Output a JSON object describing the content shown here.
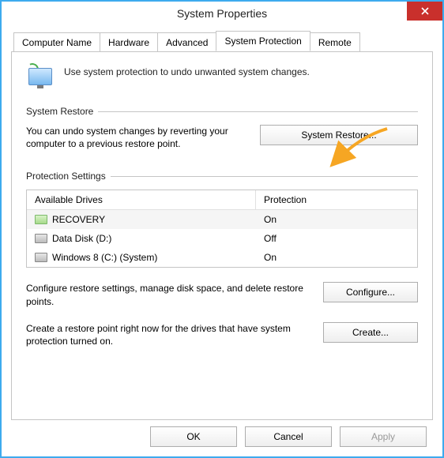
{
  "window": {
    "title": "System Properties"
  },
  "tabs": [
    {
      "label": "Computer Name"
    },
    {
      "label": "Hardware"
    },
    {
      "label": "Advanced"
    },
    {
      "label": "System Protection"
    },
    {
      "label": "Remote"
    }
  ],
  "intro": "Use system protection to undo unwanted system changes.",
  "restore": {
    "section": "System Restore",
    "desc": "You can undo system changes by reverting your computer to a previous restore point.",
    "button": "System Restore..."
  },
  "protection": {
    "section": "Protection Settings",
    "header_drives": "Available Drives",
    "header_protection": "Protection",
    "drives": [
      {
        "name": "RECOVERY",
        "protection": "On",
        "selected": true,
        "icon": "green"
      },
      {
        "name": "Data Disk (D:)",
        "protection": "Off",
        "selected": false,
        "icon": "gray"
      },
      {
        "name": "Windows 8 (C:) (System)",
        "protection": "On",
        "selected": false,
        "icon": "gray"
      }
    ],
    "configure_desc": "Configure restore settings, manage disk space, and delete restore points.",
    "configure_btn": "Configure...",
    "create_desc": "Create a restore point right now for the drives that have system protection turned on.",
    "create_btn": "Create..."
  },
  "dialog_buttons": {
    "ok": "OK",
    "cancel": "Cancel",
    "apply": "Apply"
  }
}
